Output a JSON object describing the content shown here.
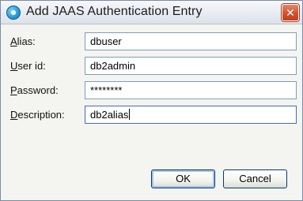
{
  "window": {
    "title": "Add JAAS Authentication Entry",
    "close_symbol": "✕",
    "title_icon": "app-icon",
    "close_icon": "close-icon"
  },
  "form": {
    "alias": {
      "label_mnemonic": "A",
      "label_rest": "lias:",
      "value": "dbuser"
    },
    "user_id": {
      "label_mnemonic": "U",
      "label_rest": "ser id:",
      "value": "db2admin"
    },
    "password": {
      "label_mnemonic": "P",
      "label_rest": "assword:",
      "value": "********"
    },
    "description": {
      "label_mnemonic": "D",
      "label_rest": "escription:",
      "value": "db2alias"
    }
  },
  "buttons": {
    "ok": "OK",
    "cancel": "Cancel"
  },
  "colors": {
    "close_button": "#d2512e",
    "field_border": "#7f9db9",
    "button_border": "#003c74"
  }
}
